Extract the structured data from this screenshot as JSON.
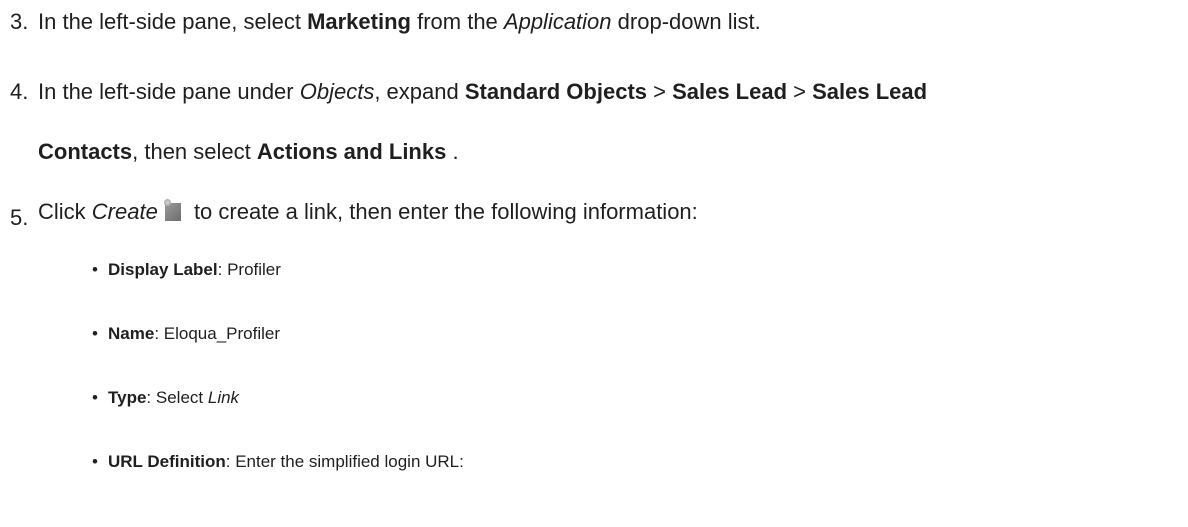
{
  "steps": [
    {
      "number": "3.",
      "parts": [
        "In the left-side pane, select ",
        "Marketing",
        " from the ",
        "Application",
        " drop-down list."
      ]
    },
    {
      "number": "4.",
      "parts": [
        "In the left-side pane under ",
        "Objects",
        ", expand ",
        "Standard Objects",
        " > ",
        "Sales Lead",
        " > ",
        "Sales Lead",
        "Contacts",
        ", then select ",
        "Actions and Links",
        " ."
      ]
    },
    {
      "number": "5.",
      "parts": [
        "Click ",
        "Create",
        " to create a link, then enter the following information:"
      ],
      "icon": "create-icon"
    }
  ],
  "fields": [
    {
      "label": "Display Label",
      "sep": ": ",
      "value": "Profiler"
    },
    {
      "label": "Name",
      "sep": ": ",
      "value": "Eloqua_Profiler"
    },
    {
      "label": "Type",
      "sep": ": ",
      "value": "Select ",
      "value_em": "Link"
    },
    {
      "label": "URL Definition",
      "sep": ": ",
      "value": "Enter the simplified login URL:"
    }
  ],
  "bullet_char": "•"
}
